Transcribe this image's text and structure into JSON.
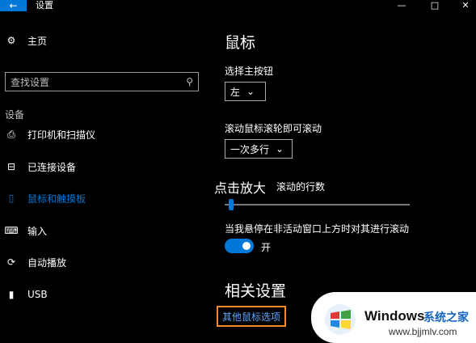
{
  "window": {
    "title": "设置",
    "back_icon": "←",
    "minimize": "—",
    "maximize": "□",
    "close": "✕"
  },
  "sidebar": {
    "home_label": "主页",
    "search_placeholder": "查找设置",
    "section_label": "设备",
    "items": [
      {
        "label": "打印机和扫描仪",
        "icon": "printer-icon"
      },
      {
        "label": "已连接设备",
        "icon": "device-icon"
      },
      {
        "label": "鼠标和触摸板",
        "icon": "mouse-icon",
        "active": true
      },
      {
        "label": "输入",
        "icon": "keyboard-icon"
      },
      {
        "label": "自动播放",
        "icon": "autoplay-icon"
      },
      {
        "label": "USB",
        "icon": "usb-icon"
      }
    ]
  },
  "main": {
    "heading": "鼠标",
    "primary_button_label": "选择主按钮",
    "primary_button_value": "左",
    "scroll_wheel_label": "滚动鼠标滚轮即可滚动",
    "scroll_wheel_value": "一次多行",
    "scroll_lines_label_partial": "滚动的行数",
    "scroll_lines_level": 0.02,
    "inactive_scroll_label": "当我悬停在非活动窗口上方时对其进行滚动",
    "inactive_scroll_state": "开",
    "related_heading": "相关设置",
    "other_mouse_options": "其他鼠标选项"
  },
  "overlay": {
    "tooltip": "点击放大"
  },
  "watermark": {
    "brand": "Windows",
    "chinese": "系统之家",
    "url": "www.bjjmlv.com"
  },
  "colors": {
    "accent": "#0078d7",
    "highlight_box": "#f28c28",
    "link": "#5ea8ff"
  }
}
